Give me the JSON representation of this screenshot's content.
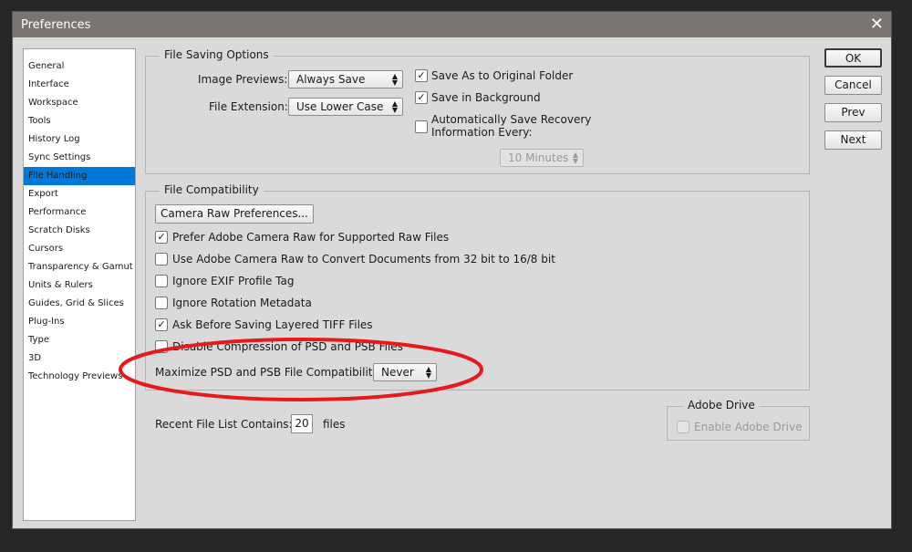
{
  "title": "Preferences",
  "sidebar": [
    "General",
    "Interface",
    "Workspace",
    "Tools",
    "History Log",
    "Sync Settings",
    "File Handling",
    "Export",
    "Performance",
    "Scratch Disks",
    "Cursors",
    "Transparency & Gamut",
    "Units & Rulers",
    "Guides, Grid & Slices",
    "Plug-Ins",
    "Type",
    "3D",
    "Technology Previews"
  ],
  "buttons": {
    "ok": "OK",
    "cancel": "Cancel",
    "prev": "Prev",
    "next": "Next"
  },
  "saving": {
    "legend": "File Saving Options",
    "image_previews_label": "Image Previews:",
    "image_previews_value": "Always Save",
    "file_ext_label": "File Extension:",
    "file_ext_value": "Use Lower Case",
    "save_original": "Save As to Original Folder",
    "save_background": "Save in Background",
    "auto_save_1": "Automatically Save Recovery",
    "auto_save_2": "Information Every:",
    "interval": "10 Minutes"
  },
  "compat": {
    "legend": "File Compatibility",
    "camera_raw_button": "Camera Raw Preferences...",
    "options": [
      {
        "label": "Prefer Adobe Camera Raw for Supported Raw Files",
        "checked": true
      },
      {
        "label": "Use Adobe Camera Raw to Convert Documents from 32 bit to 16/8 bit",
        "checked": false
      },
      {
        "label": "Ignore EXIF Profile Tag",
        "checked": false
      },
      {
        "label": "Ignore Rotation Metadata",
        "checked": false
      },
      {
        "label": "Ask Before Saving Layered TIFF Files",
        "checked": true
      },
      {
        "label": "Disable Compression of PSD and PSB Files",
        "checked": false
      }
    ],
    "maximize_label": "Maximize PSD and PSB File Compatibility:",
    "maximize_value": "Never"
  },
  "recent": {
    "label": "Recent File List Contains:",
    "value": "20",
    "suffix": "files"
  },
  "drive": {
    "legend": "Adobe Drive",
    "enable": "Enable Adobe Drive"
  },
  "highlight_color": "#e8191b"
}
